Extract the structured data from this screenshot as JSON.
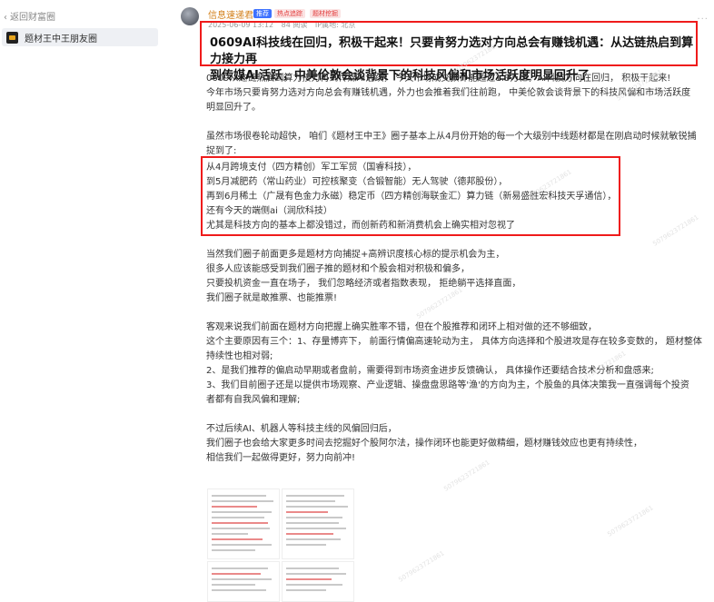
{
  "sidebar": {
    "back_label": "返回财富圈",
    "circle_name": "题材王中王朋友圈"
  },
  "post": {
    "author": "信息速递君",
    "tags": [
      "推荐",
      "热点追踪",
      "题材挖掘"
    ],
    "date": "2025-06-09 13:12",
    "views": "84 阅读",
    "ip": "IP属地: 北京",
    "title_line1": "0609AI科技线在回归，积极干起来！只要肯努力选对方向总会有赚钱机遇：从达链热启到算力接力再",
    "title_line2": "到传媒AI活跃，中美伦敦会谈背景下的科技风偏和市场活跃度明显回升了",
    "paragraphs": [
      "0609从达链热启到算力接力再到传媒AI活跃，  今天市场成交预计能超过1.3万亿，AI科技方向在回归，  积极干起来!",
      "今年市场只要肯努力选对方向总会有赚钱机遇，外力也会推着我们往前跑，  中美伦敦会谈背景下的科技风偏和市场活跃度",
      "明显回升了。",
      "虽然市场很卷轮动超快，  咱们《题材王中王》圈子基本上从4月份开始的每一个大级别中线题材都是在刚启动时候就敏锐捕",
      "捉到了:",
      "从4月跨境支付（四方精创）军工军贸（国睿科技），",
      "到5月减肥药（常山药业）可控核聚变（合锻智能）无人驾驶（德邦股份），",
      "再到6月稀土（广晟有色金力永磁）稳定币（四方精创海联金汇）算力链（新易盛胜宏科技天孚通信），",
      "还有今天的端侧ai（润欣科技）",
      "尤其是科技方向的基本上都没错过，而创新药和新消费机会上确实相对忽视了",
      "当然我们圈子前面更多是题材方向捕捉+高辨识度核心标的提示机会为主，",
      "很多人应该能感受到我们圈子推的题材和个股会相对积极和偏多，",
      "只要投机资金一直在场子，  我们忽略经济或者指数表现，  拒绝躺平选择直面，",
      "我们圈子就是敢推票、也能推票!",
      "客观来说我们前面在题材方向把握上确实胜率不错，但在个股推荐和闭环上相对做的还不够细致，",
      "这个主要原因有三个：1、存量博弈下，  前面行情偏高速轮动为主，  具体方向选择和个股进攻是存在较多变数的，  题材整体",
      "持续性也相对弱;",
      "2、是我们推荐的偏启动早期或者盘前，需要得到市场资金进步反馈确认，    具体操作还要结合技术分析和盘感来;",
      "3、我们目前圈子还是以提供市场观察、产业逻辑、操盘盘思路等'渔'的方向为主，个股鱼的具体决策我一直强调每个投资",
      "者都有自我风偏和理解;",
      "不过后续AI、机器人等科技主线的风偏回归后，",
      "我们圈子也会给大家更多时间去挖掘好个股阿尔法，操作闭环也能更好做精细，题材赚钱效应也更有持续性，",
      "相信我们一起做得更好，努力向前冲!"
    ],
    "watermark": "5079623721861"
  }
}
